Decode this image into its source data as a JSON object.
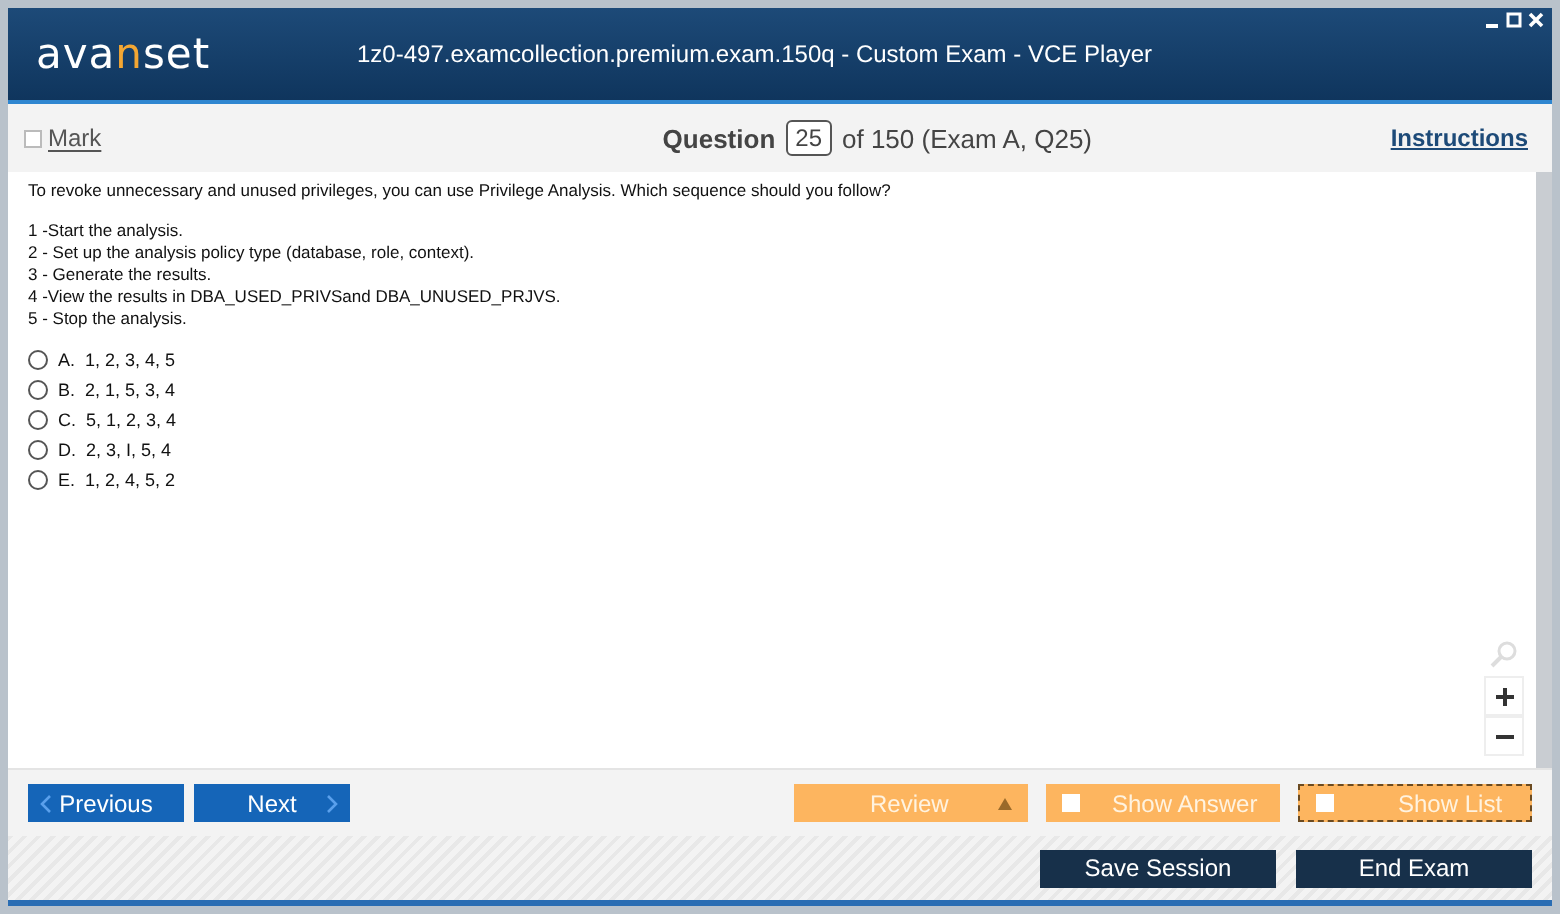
{
  "window": {
    "logo": [
      {
        "text": "ava",
        "accent": false
      },
      {
        "text": "n",
        "accent": true
      },
      {
        "text": "set",
        "accent": false
      }
    ],
    "title": "1z0-497.examcollection.premium.exam.150q - Custom Exam - VCE Player"
  },
  "header": {
    "mark": {
      "label": "Mark",
      "checked": false
    },
    "question_label": "Question",
    "question_number": "25",
    "question_of": "of 150 (Exam A, Q25)",
    "instructions": "Instructions"
  },
  "question": {
    "prompt": "To revoke unnecessary and unused privileges, you can use Privilege Analysis. Which sequence should you follow?",
    "steps": [
      "1 -Start the analysis.",
      "2 - Set up the analysis policy type (database, role, context).",
      "3 - Generate the results.",
      "4 -View the results in DBA_USED_PRIVSand DBA_UNUSED_PRJVS.",
      "5 - Stop the analysis."
    ],
    "options": [
      {
        "letter": "A.",
        "text": "1, 2, 3, 4, 5",
        "selected": false
      },
      {
        "letter": "B.",
        "text": "2, 1, 5, 3, 4",
        "selected": false
      },
      {
        "letter": "C.",
        "text": "5, 1, 2, 3, 4",
        "selected": false
      },
      {
        "letter": "D.",
        "text": "2, 3, I, 5, 4",
        "selected": false
      },
      {
        "letter": "E.",
        "text": "1, 2, 4, 5, 2",
        "selected": false
      }
    ]
  },
  "nav": {
    "previous": "Previous",
    "next": "Next",
    "review": "Review",
    "show_answer": {
      "label": "Show Answer",
      "checked": false
    },
    "show_list": {
      "label": "Show List",
      "checked": false
    }
  },
  "footer": {
    "save": "Save Session",
    "end": "End Exam"
  }
}
